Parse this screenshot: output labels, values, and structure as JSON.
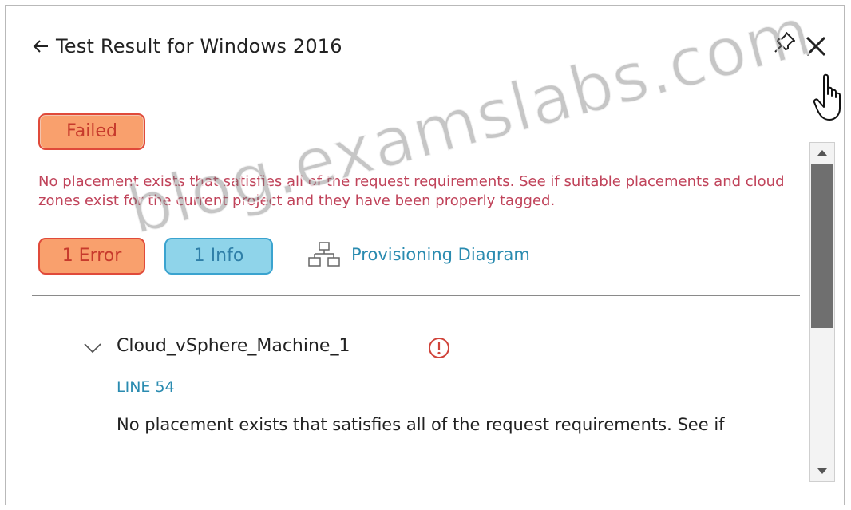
{
  "header": {
    "title": "Test Result for Windows 2016"
  },
  "status": {
    "badge": "Failed",
    "message": "No placement exists that satisfies all of the request requirements. See if suitable placements and cloud zones exist for the current project and they have been properly tagged."
  },
  "summary": {
    "error_badge": "1 Error",
    "info_badge": "1 Info",
    "diagram_link": "Provisioning Diagram"
  },
  "result_item": {
    "name": "Cloud_vSphere_Machine_1",
    "line": "LINE 54",
    "detail": "No placement exists that satisfies all of the request requirements. See if"
  },
  "watermark": "blog.examslabs.com",
  "colors": {
    "failed_fill": "#f9a06d",
    "failed_border": "#e04a3a",
    "info_fill": "#8fd4ea",
    "link": "#2a8bb0",
    "error_text": "#c0435a"
  },
  "icons": [
    "back-arrow-icon",
    "pin-icon",
    "close-icon",
    "hand-cursor-icon",
    "diagram-icon",
    "chevron-down-icon",
    "warning-icon",
    "scroll-up-icon",
    "scroll-down-icon"
  ]
}
